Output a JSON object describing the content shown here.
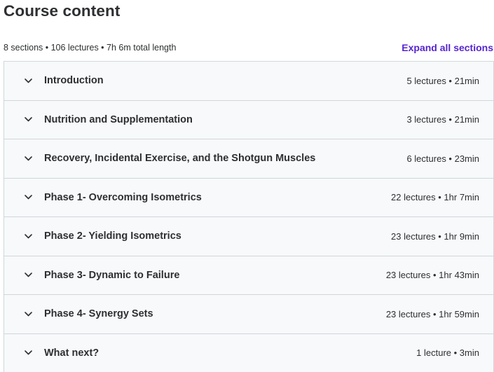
{
  "header": {
    "title": "Course content",
    "summary": "8 sections • 106 lectures • 7h 6m total length",
    "expand_label": "Expand all sections"
  },
  "colors": {
    "accent": "#5624d0",
    "section_bg": "#f7f9fa",
    "border": "#d1d7dc",
    "text": "#2d2f31"
  },
  "sections": [
    {
      "title": "Introduction",
      "meta": "5 lectures • 21min",
      "icon": "chevron-down-icon"
    },
    {
      "title": "Nutrition and Supplementation",
      "meta": "3 lectures • 21min",
      "icon": "chevron-down-icon"
    },
    {
      "title": "Recovery, Incidental Exercise, and the Shotgun Muscles",
      "meta": "6 lectures • 23min",
      "icon": "chevron-down-icon"
    },
    {
      "title": "Phase 1- Overcoming Isometrics",
      "meta": "22 lectures • 1hr 7min",
      "icon": "chevron-down-icon"
    },
    {
      "title": "Phase 2- Yielding Isometrics",
      "meta": "23 lectures • 1hr 9min",
      "icon": "chevron-down-icon"
    },
    {
      "title": "Phase 3- Dynamic to Failure",
      "meta": "23 lectures • 1hr 43min",
      "icon": "chevron-down-icon"
    },
    {
      "title": "Phase 4- Synergy Sets",
      "meta": "23 lectures • 1hr 59min",
      "icon": "chevron-down-icon"
    },
    {
      "title": "What next?",
      "meta": "1 lecture • 3min",
      "icon": "chevron-down-icon"
    }
  ]
}
